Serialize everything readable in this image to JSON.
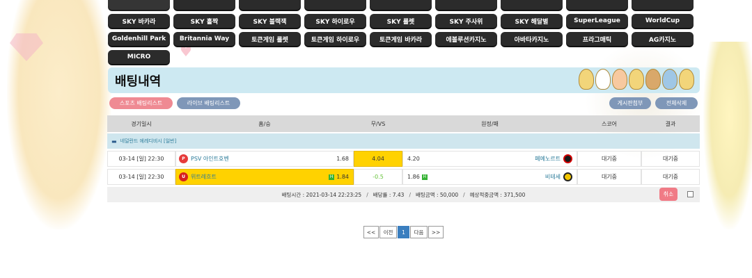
{
  "categories": {
    "row1": [
      "SKY 바카라",
      "SKY 홀짝",
      "SKY 블랙잭",
      "SKY 하이로우",
      "SKY 룰렛",
      "SKY 주사위",
      "SKY 해달별",
      "SuperLeague",
      "WorldCup"
    ],
    "row2": [
      "Goldenhill Park",
      "Britannia Way",
      "토큰게임 룰렛",
      "토큰게임 하이로우",
      "토큰게임 바카라",
      "에볼루션카지노",
      "아바타카지노",
      "프라그매틱",
      "AG카지노"
    ],
    "row3": [
      "MICRO"
    ]
  },
  "section": {
    "title": "배팅내역"
  },
  "tabs": {
    "sports": "스포츠 배팅리스트",
    "live": "라이브 배팅리스트"
  },
  "actions": {
    "post": "게시판첨부",
    "delete_all": "전체삭제"
  },
  "table": {
    "headers": {
      "date": "경기일시",
      "home": "홈/승",
      "vs": "무/VS",
      "away": "원정/패",
      "score": "스코어",
      "result": "결과"
    },
    "league": "네덜란드 에레디비시 [일반]",
    "rows": [
      {
        "date": "03-14 [일] 22:30",
        "home": "PSV 아인트호벤",
        "home_odds": "1.68",
        "vs": "4.04",
        "away_odds": "4.20",
        "away": "페예노르트",
        "score": "대기중",
        "result": "대기중"
      },
      {
        "date": "03-14 [일] 22:30",
        "home": "위트레흐트",
        "home_odds": "1.84",
        "vs": "-0.5",
        "away_odds": "1.86",
        "away": "비테세",
        "score": "대기중",
        "result": "대기중"
      }
    ],
    "summary": {
      "bet_time": "배팅시간 : 2021-03-14 22:23:25",
      "odds": "배당률 : 7.43",
      "amount": "배팅금액 : 50,000",
      "expected": "예상적중금액 : 371,500"
    },
    "cancel": "취소",
    "up_mark": "H"
  },
  "pagination": {
    "first": "<<",
    "prev": "이전",
    "current": "1",
    "next": "다음",
    "last": ">>"
  },
  "colors": {
    "accent_yellow": "#ffd200",
    "header_blue": "#cde9f2",
    "pill_pink": "#ef8a93",
    "pill_blue": "#7f97b8",
    "page_active": "#3a7ebf"
  },
  "icons": {
    "league_flag": "netherlands-flag-icon",
    "up": "up-arrow-icon"
  }
}
